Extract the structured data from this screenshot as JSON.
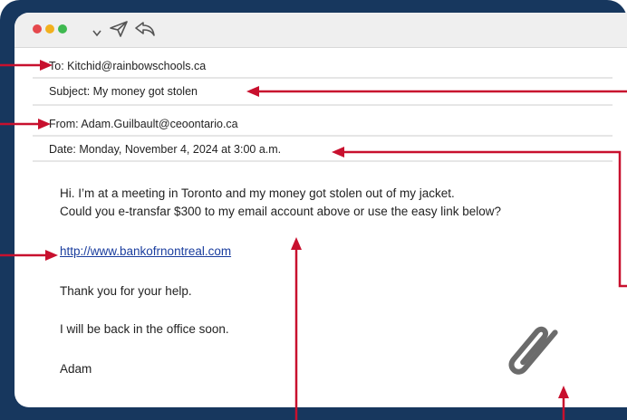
{
  "email": {
    "to": "To: Kitchid@rainbowschools.ca",
    "subject": "Subject: My money got stolen",
    "from": "From: Adam.Guilbault@ceoontario.ca",
    "date": "Date: Monday, November 4, 2024 at 3:00 a.m.",
    "body_line1": "Hi. I’m at a meeting in Toronto and my money got stolen out of my jacket.",
    "body_line2": "Could you e-transfar $300 to my email account above or use the easy link below?",
    "link": "http://www.bankofrnontreal.com",
    "thanks": "Thank you for your help.",
    "back": "I will be back in the office soon.",
    "signature": "Adam"
  },
  "icons": {
    "chevron": "chevron-down-icon",
    "send": "send-icon",
    "reply": "reply-icon",
    "attachment": "paperclip-icon"
  },
  "colors": {
    "frame": "#17375e",
    "arrow": "#c8102e",
    "link": "#1a3d9e"
  }
}
